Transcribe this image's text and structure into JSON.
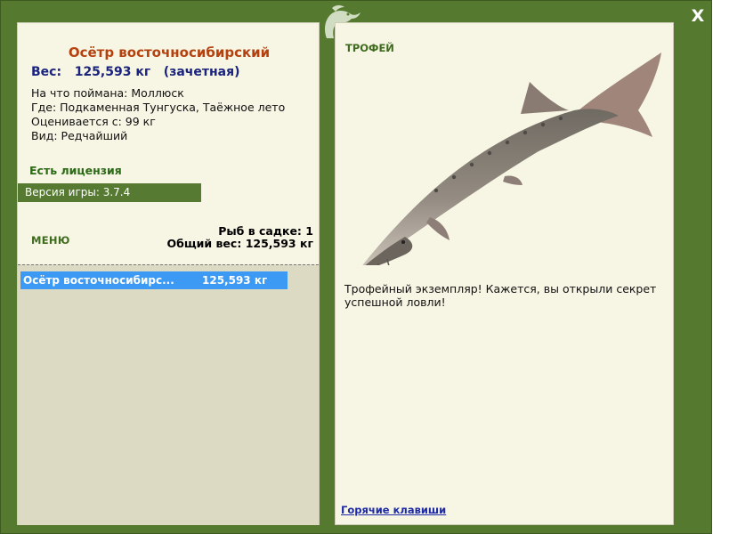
{
  "window": {
    "close_label": "X",
    "colors": {
      "frame": "#557a2f",
      "panel": "#f7f5e3",
      "accent_text": "#b5410f",
      "selection": "#3c9af5"
    }
  },
  "catch": {
    "fish_name": "Осётр восточносибирский",
    "weight_label": "Вес:",
    "weight_value": "125,593 кг",
    "weight_note": "(зачетная)",
    "details": [
      {
        "label": "На что поймана:",
        "value": "Моллюск"
      },
      {
        "label": "Где:",
        "value": "Подкаменная Тунгуска, Таёжное лето"
      },
      {
        "label": "Оценивается с:",
        "value": "99 кг"
      },
      {
        "label": "Вид:",
        "value": "Редчайший"
      }
    ],
    "license_text": "Есть лицензия",
    "version_text": "Версия игры: 3.7.4"
  },
  "menu": {
    "label": "МЕНЮ"
  },
  "keepnet": {
    "count_label": "Рыб в садке:",
    "count_value": "1",
    "total_label": "Общий вес:",
    "total_value": "125,593 кг",
    "items": [
      {
        "name": "Осётр восточносибирс...",
        "weight": "125,593 кг"
      }
    ]
  },
  "trophy": {
    "label": "ТРОФЕЙ",
    "image_icon": "sturgeon-fish-image",
    "message": "Трофейный экземпляр! Кажется, вы открыли секрет успешной ловли!",
    "hotkeys_link": "Горячие клавиши"
  }
}
